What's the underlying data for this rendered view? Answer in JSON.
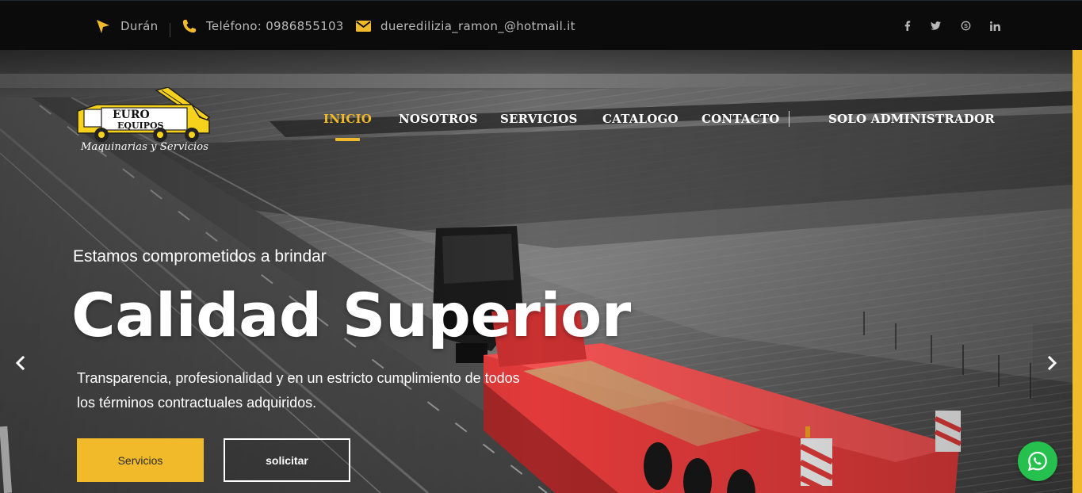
{
  "topbar": {
    "location": "Durán",
    "phone": "Teléfono: 0986855103",
    "email": "dueredilizia_ramon_@hotmail.it",
    "social": [
      {
        "name": "facebook-icon",
        "glyph": "f"
      },
      {
        "name": "twitter-icon",
        "glyph": "t"
      },
      {
        "name": "skype-icon",
        "glyph": "s"
      },
      {
        "name": "linkedin-icon",
        "glyph": "in"
      }
    ]
  },
  "logo": {
    "line1": "EURO",
    "line2": "EQUIPOS",
    "tagline": "Maquinarias y Servicios"
  },
  "nav": {
    "items": [
      "INICIO",
      "NOSOTROS",
      "SERVICIOS",
      "CATALOGO",
      "CONTACTO"
    ],
    "admin": "SOLO ADMINISTRADOR",
    "active_index": 0
  },
  "hero": {
    "subtitle": "Estamos comprometidos a brindar",
    "headline": "Calidad Superior",
    "description": "Transparencia, profesionalidad y en un estricto cumplimiento de todos los términos contractuales adquiridos.",
    "primary_button": "Servicios",
    "secondary_button": "solicitar"
  },
  "colors": {
    "accent": "#f1ba2b",
    "topbar_bg": "#0b0b0b",
    "whatsapp": "#25c04d",
    "trailer_red": "#e23a3a"
  }
}
